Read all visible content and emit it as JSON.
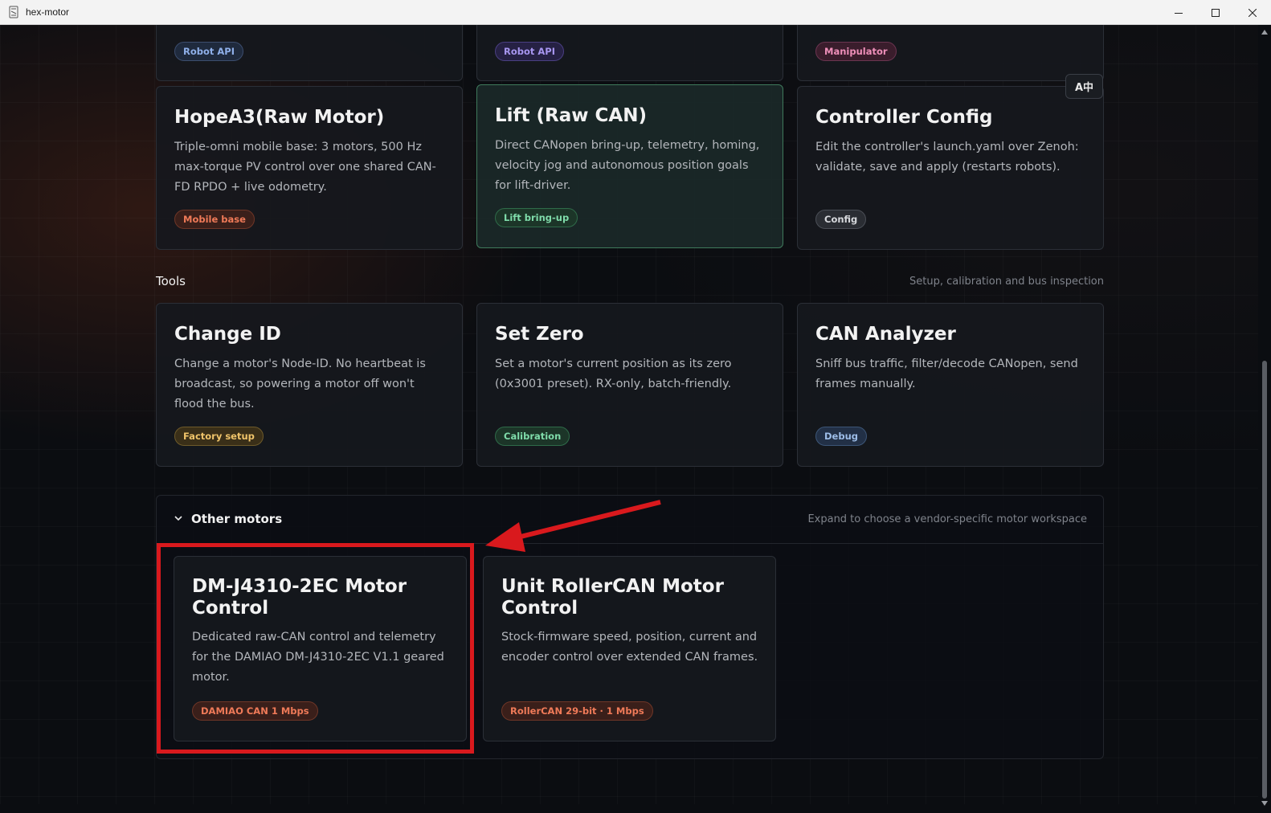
{
  "window": {
    "title": "hex-motor"
  },
  "top_row": {
    "tags": [
      "Robot API",
      "Robot API",
      "Manipulator"
    ]
  },
  "lang_toggle": "A中",
  "motors_row": [
    {
      "title": "HopeA3(Raw Motor)",
      "description": "Triple-omni mobile base: 3 motors, 500 Hz max-torque PV control over one shared CAN-FD RPDO + live odometry.",
      "tag": "Mobile base"
    },
    {
      "title": "Lift (Raw CAN)",
      "description": "Direct CANopen bring-up, telemetry, homing, velocity jog and autonomous position goals for lift-driver.",
      "tag": "Lift bring-up"
    },
    {
      "title": "Controller Config",
      "description": "Edit the controller's launch.yaml over Zenoh: validate, save and apply (restarts robots).",
      "tag": "Config"
    }
  ],
  "tools": {
    "title": "Tools",
    "hint": "Setup, calibration and bus inspection",
    "cards": [
      {
        "title": "Change ID",
        "description": "Change a motor's Node-ID. No heartbeat is broadcast, so powering a motor off won't flood the bus.",
        "tag": "Factory setup"
      },
      {
        "title": "Set Zero",
        "description": "Set a motor's current position as its zero (0x3001 preset). RX-only, batch-friendly.",
        "tag": "Calibration"
      },
      {
        "title": "CAN Analyzer",
        "description": "Sniff bus traffic, filter/decode CANopen, send frames manually.",
        "tag": "Debug"
      }
    ]
  },
  "other_motors": {
    "title": "Other motors",
    "hint": "Expand to choose a vendor-specific motor workspace",
    "cards": [
      {
        "title": "DM-J4310-2EC Motor Control",
        "description": "Dedicated raw-CAN control and telemetry for the DAMIAO DM-J4310-2EC V1.1 geared motor.",
        "tag": "DAMIAO CAN 1 Mbps"
      },
      {
        "title": "Unit RollerCAN Motor Control",
        "description": "Stock-firmware speed, position, current and encoder control over extended CAN frames.",
        "tag": "RollerCAN 29-bit · 1 Mbps"
      }
    ]
  },
  "colors": {
    "highlight": "#d9191d",
    "active_border": "#3f7a5c"
  }
}
